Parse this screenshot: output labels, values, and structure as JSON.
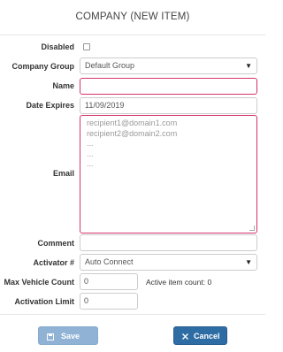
{
  "header": {
    "title": "COMPANY (NEW ITEM)"
  },
  "form": {
    "disabled_label": "Disabled",
    "company_group_label": "Company Group",
    "company_group_value": "Default Group",
    "name_label": "Name",
    "name_value": "",
    "date_expires_label": "Date Expires",
    "date_expires_value": "11/09/2019",
    "email_label": "Email",
    "email_placeholder_lines": [
      "recipient1@domain1.com",
      "recipient2@domain2.com",
      "...",
      "...",
      "..."
    ],
    "comment_label": "Comment",
    "comment_value": "",
    "activator_label": "Activator #",
    "activator_value": "Auto Connect",
    "max_vehicle_label": "Max Vehicle Count",
    "max_vehicle_value": "0",
    "active_count_text": "Active item count: 0",
    "activation_limit_label": "Activation Limit",
    "activation_limit_value": "0"
  },
  "footer": {
    "save_label": "Save",
    "cancel_label": "Cancel"
  },
  "colors": {
    "invalid_border": "#d6336c",
    "primary": "#2e6da4",
    "primary_disabled": "#8fb2d5"
  },
  "icons": {
    "save": "floppy-disk-icon",
    "cancel": "close-icon",
    "dropdown": "caret-down-icon"
  }
}
